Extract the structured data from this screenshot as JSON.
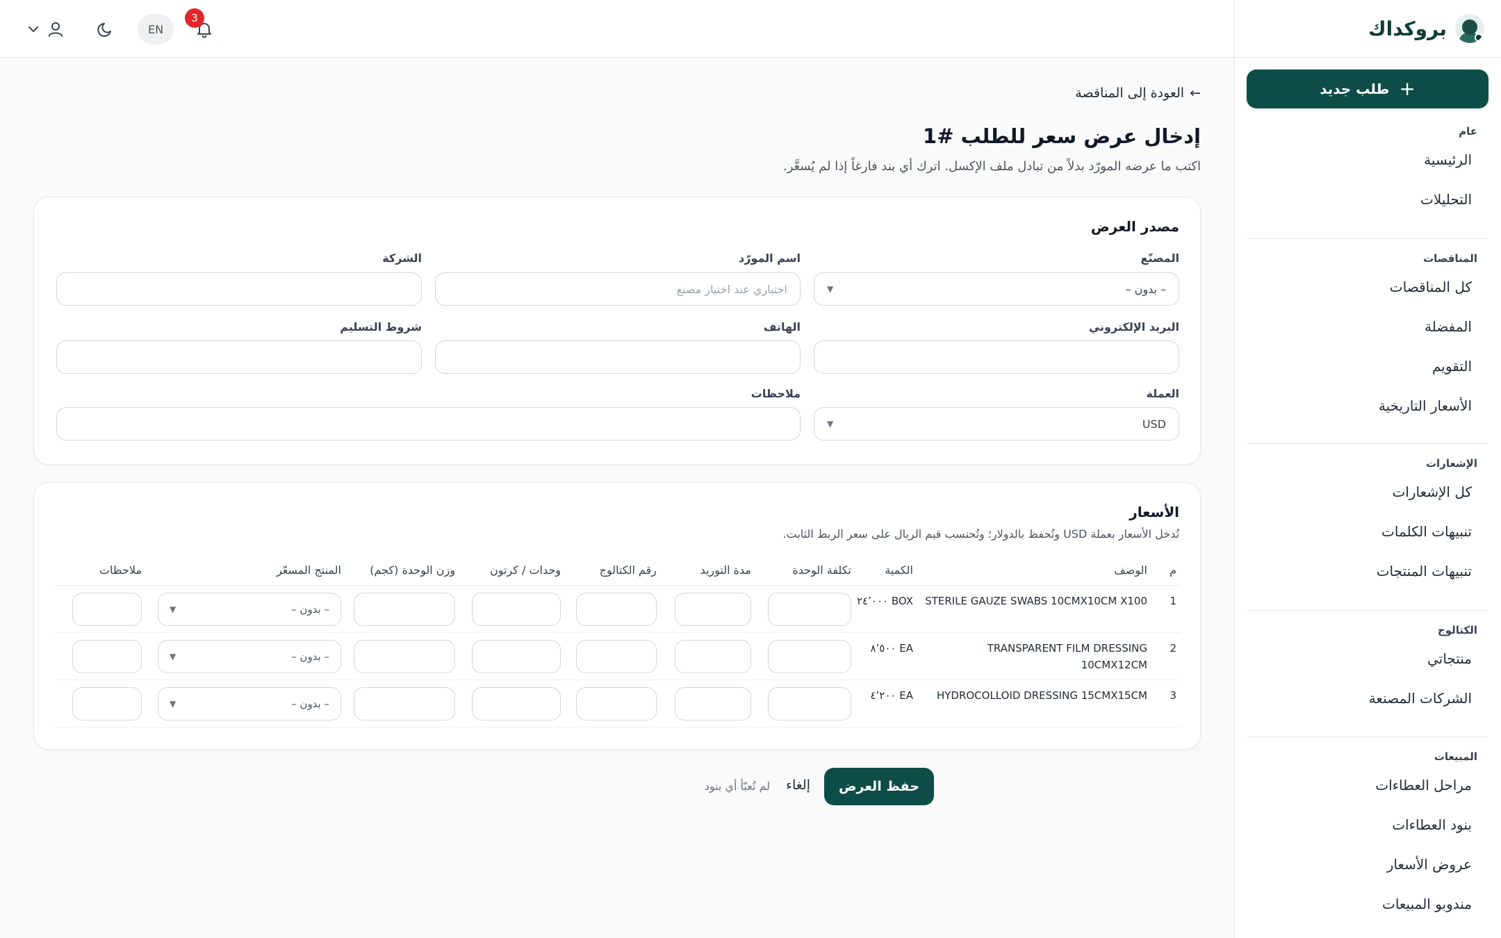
{
  "brand": {
    "name": "بروكداك"
  },
  "sidebar": {
    "new_button": "طلب جديد",
    "groups": [
      {
        "heading": "عام",
        "items": [
          "الرئيسية",
          "التحليلات"
        ]
      },
      {
        "heading": "المناقصات",
        "items": [
          "كل المناقصات",
          "المفضلة",
          "التقويم",
          "الأسعار التاريخية"
        ]
      },
      {
        "heading": "الإشعارات",
        "items": [
          "كل الإشعارات",
          "تنبيهات الكلمات",
          "تنبيهات المنتجات"
        ]
      },
      {
        "heading": "الكتالوج",
        "items": [
          "منتجاتي",
          "الشركات المصنعة"
        ]
      },
      {
        "heading": "المبيعات",
        "items": [
          "مراحل العطاءات",
          "بنود العطاءات",
          "عروض الأسعار",
          "مندوبو المبيعات"
        ]
      }
    ]
  },
  "topbar": {
    "lang": "EN",
    "notification_count": "3",
    "icons": [
      "bell-icon",
      "moon-icon",
      "user-icon",
      "chevron-down-icon"
    ]
  },
  "page": {
    "back_link": "العودة إلى المناقصة",
    "back_arrow": "←",
    "title": "إدخال عرض سعر للطلب #1",
    "subtitle": "اكتب ما عرضه المورّد بدلاً من تبادل ملف الإكسل. اترك أي بند فارغاً إذا لم يُسعَّر."
  },
  "source": {
    "title": "مصدر العرض",
    "manufacturer_label": "المصنّع",
    "manufacturer_value": "– بدون –",
    "supplier_label": "اسم المورّد",
    "supplier_placeholder": "اختياري عند اختيار مصنع",
    "company_label": "الشركة",
    "email_label": "البريد الإلكتروني",
    "phone_label": "الهاتف",
    "delivery_label": "شروط التسليم",
    "currency_label": "العملة",
    "currency_value": "USD",
    "notes_label": "ملاحظات"
  },
  "prices": {
    "title": "الأسعار",
    "hint": "تُدخل الأسعار بعملة USD وتُحفظ بالدولار؛ وتُحتسب قيم الريال على سعر الربط الثابت.",
    "columns": {
      "num": "م",
      "desc": "الوصف",
      "qty": "الكمية",
      "unit_cost": "تكلفة الوحدة",
      "lead": "مدة التوريد",
      "catalog": "رقم الكتالوج",
      "units_carton": "وحدات / كرتون",
      "unit_weight": "وزن الوحدة (كجم)",
      "product": "المنتج المسعّر",
      "notes": "ملاحظات"
    },
    "rows": [
      {
        "num": "1",
        "desc": "STERILE GAUZE SWABS 10CMX10CM X100",
        "qty": "BOX ٢٤٬٠٠٠",
        "product": "– بدون –"
      },
      {
        "num": "2",
        "desc": "TRANSPARENT FILM DRESSING 10CMX12CM",
        "qty": "EA ٨٬٥٠٠",
        "product": "– بدون –"
      },
      {
        "num": "3",
        "desc": "HYDROCOLLOID DRESSING 15CMX15CM",
        "qty": "EA ٤٬٢٠٠",
        "product": "– بدون –"
      }
    ]
  },
  "actions": {
    "save": "حفظ العرض",
    "cancel": "إلغاء",
    "status": "لم تُعبّأ أي بنود"
  }
}
